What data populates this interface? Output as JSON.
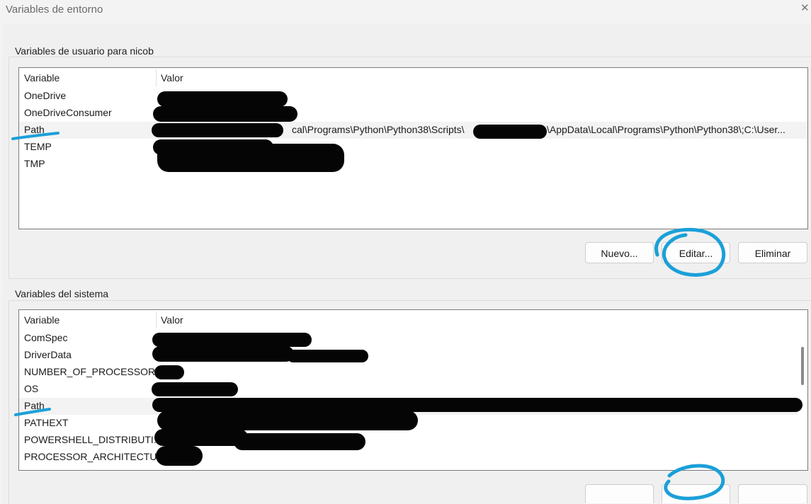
{
  "window": {
    "title": "Variables de entorno"
  },
  "user_section": {
    "label": "Variables de usuario para nicob",
    "columns": {
      "variable": "Variable",
      "value": "Valor"
    },
    "rows": [
      {
        "name": "OneDrive",
        "value": ""
      },
      {
        "name": "OneDriveConsumer",
        "value": ""
      },
      {
        "name": "Path",
        "value_parts": [
          "cal\\Programs\\Python\\Python38\\Scripts\\",
          "\\AppData\\Local\\Programs\\Python\\Python38\\;C:\\User..."
        ]
      },
      {
        "name": "TEMP",
        "value": ""
      },
      {
        "name": "TMP",
        "value": ""
      }
    ],
    "buttons": {
      "new": "Nuevo...",
      "edit": "Editar...",
      "delete": "Eliminar"
    }
  },
  "system_section": {
    "label": "Variables del sistema",
    "columns": {
      "variable": "Variable",
      "value": "Valor"
    },
    "rows": [
      {
        "name": "ComSpec"
      },
      {
        "name": "DriverData"
      },
      {
        "name": "NUMBER_OF_PROCESSORS"
      },
      {
        "name": "OS"
      },
      {
        "name": "Path"
      },
      {
        "name": "PATHEXT"
      },
      {
        "name": "POWERSHELL_DISTRIBUTI..."
      },
      {
        "name": "PROCESSOR_ARCHITECTU..."
      }
    ]
  },
  "icons": {
    "close": "close-icon"
  },
  "colors": {
    "annotation": "#1ba0d8",
    "redaction": "#050505",
    "selected_row": "#f3f3f3"
  }
}
